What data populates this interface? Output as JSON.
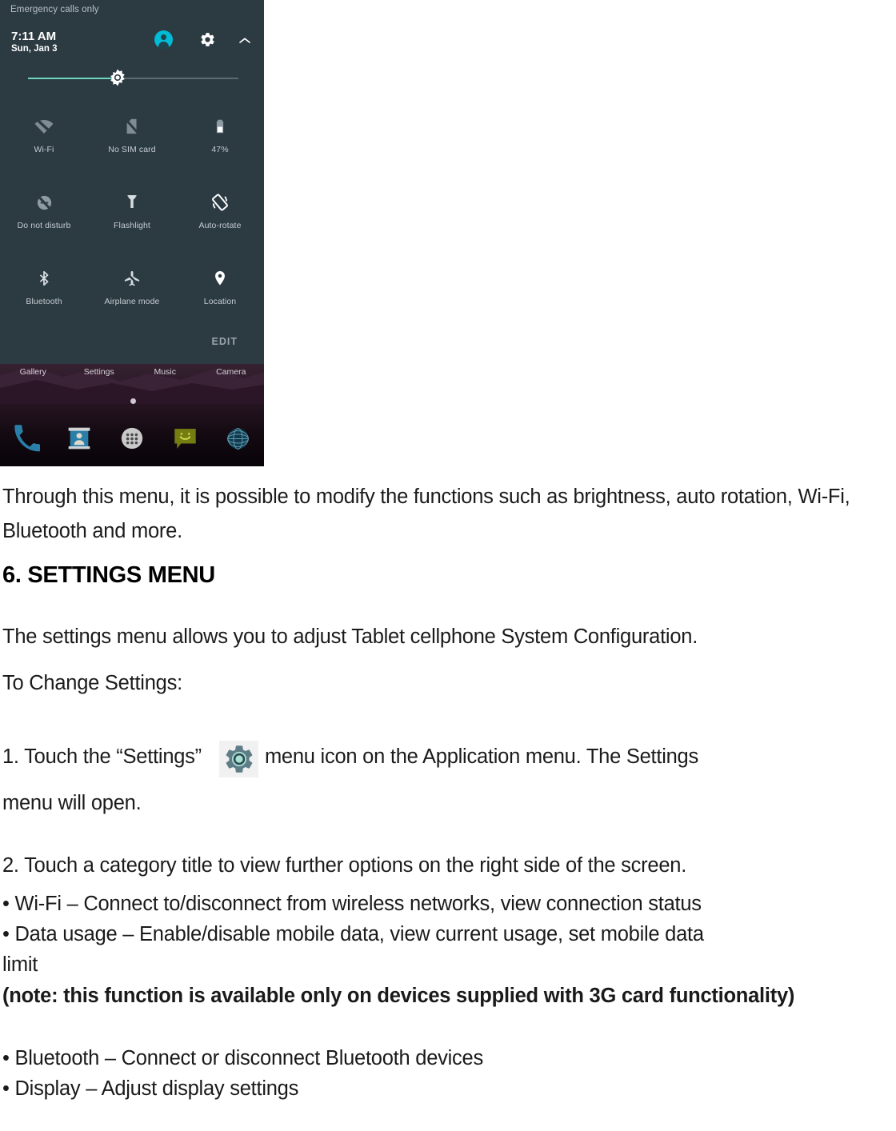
{
  "screenshot": {
    "status_bar": {
      "carrier": "Emergency calls only"
    },
    "header": {
      "time": "7:11 AM",
      "date": "Sun, Jan 3",
      "avatar_icon": "user-avatar-icon",
      "settings_icon": "gear-icon",
      "collapse_icon": "chevron-up-icon"
    },
    "brightness": {
      "icon": "brightness-sun-icon",
      "level_percent": 42
    },
    "tiles": [
      {
        "label": "Wi-Fi",
        "icon": "wifi-off-icon"
      },
      {
        "label": "No SIM card",
        "icon": "sim-card-off-icon"
      },
      {
        "label": "47%",
        "icon": "battery-icon"
      },
      {
        "label": "Do not disturb",
        "icon": "do-not-disturb-icon"
      },
      {
        "label": "Flashlight",
        "icon": "flashlight-icon"
      },
      {
        "label": "Auto-rotate",
        "icon": "auto-rotate-icon"
      },
      {
        "label": "Bluetooth",
        "icon": "bluetooth-icon"
      },
      {
        "label": "Airplane mode",
        "icon": "airplane-mode-icon"
      },
      {
        "label": "Location",
        "icon": "location-pin-icon"
      }
    ],
    "edit_label": "EDIT",
    "app_labels": [
      "Gallery",
      "Settings",
      "Music",
      "Camera"
    ],
    "dock": [
      {
        "name": "phone-icon"
      },
      {
        "name": "contacts-icon"
      },
      {
        "name": "app-drawer-icon"
      },
      {
        "name": "messaging-icon"
      },
      {
        "name": "browser-icon"
      }
    ],
    "colors": {
      "shade_background": "#2c3a42",
      "accent_cyan": "#00bcd4",
      "slider_fill": "#6fd6c0"
    }
  },
  "document": {
    "intro_paragraph": "Through this menu, it is possible to modify the functions such as brightness, auto rotation, Wi-Fi, Bluetooth and more.",
    "heading": "6. SETTINGS MENU",
    "paragraph_settings": "The settings menu allows you to adjust Tablet cellphone System Configuration.",
    "paragraph_change": "To Change Settings:",
    "step1_before_icon": "1. Touch the “Settings”",
    "step1_icon": "settings-gear-icon",
    "step1_after_icon": "menu icon on the Application menu. The Settings",
    "step1_continuation": "menu will open.",
    "step2": "2. Touch a category title to view further options on the right side of the screen.",
    "bullets": [
      "• Wi-Fi – Connect to/disconnect from wireless networks, view connection status",
      "• Data usage – Enable/disable mobile data, view current usage, set mobile data",
      "limit"
    ],
    "note": "(note: this function is available only on devices supplied with 3G card functionality)",
    "bullets_after": [
      "• Bluetooth – Connect or disconnect Bluetooth devices",
      "• Display – Adjust display settings"
    ],
    "gear_icon_colors": {
      "teeth": "#5f7d87",
      "center": "#a9e2d4"
    }
  }
}
